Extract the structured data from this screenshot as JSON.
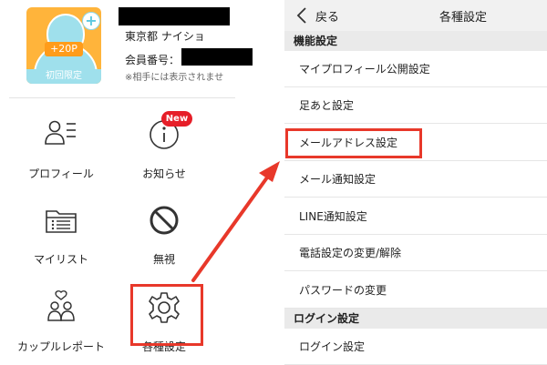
{
  "profile": {
    "points_badge": "+20P",
    "limited_label": "初回限定",
    "location": "東京都 ナイショ",
    "member_no_label": "会員番号：",
    "note": "※相手には表示されませ"
  },
  "menu": {
    "profile_label": "プロフィール",
    "notice_label": "お知らせ",
    "notice_badge": "New",
    "mylist_label": "マイリスト",
    "ignore_label": "無視",
    "couple_label": "カップルレポート",
    "settings_label": "各種設定"
  },
  "settings_screen": {
    "back_label": "戻る",
    "title": "各種設定",
    "sections": [
      {
        "header": "機能設定",
        "items": [
          "マイプロフィール公開設定",
          "足あと設定",
          "メールアドレス設定",
          "メール通知設定",
          "LINE通知設定",
          "電話設定の変更/解除",
          "パスワードの変更"
        ]
      },
      {
        "header": "ログイン設定",
        "items": [
          "ログイン設定"
        ]
      }
    ]
  },
  "colors": {
    "highlight": "#e8382a",
    "badge_red": "#e61e28",
    "avatar_orange": "#ffb43b",
    "avatar_blue": "#9fe0ec"
  }
}
